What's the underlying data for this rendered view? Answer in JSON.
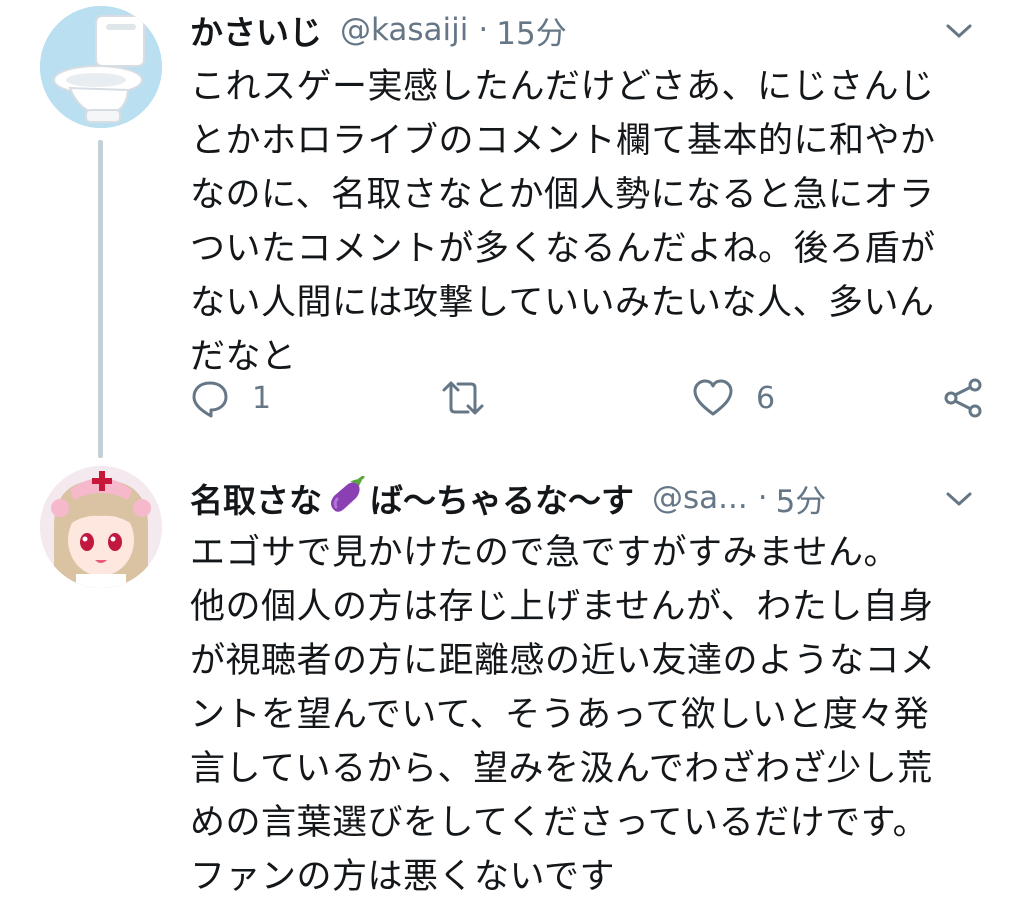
{
  "tweets": [
    {
      "name": "かさいじ",
      "handle": "@kasaiji",
      "separator": "·",
      "time": "15分",
      "avatar_icon": "toilet-icon",
      "text_lines": [
        "これスゲー実感したんだけどさあ、にじさんじ",
        "とかホロライブのコメント欄て基本的に和やか",
        "なのに、名取さなとか個人勢になると急にオラ",
        "ついたコメントが多くなるんだよね。後ろ盾が",
        "ない人間には攻撃していいみたいな人、多いん",
        "だなと"
      ],
      "actions": {
        "reply_icon": "reply-icon",
        "reply_count": "1",
        "retweet_icon": "retweet-icon",
        "like_icon": "heart-icon",
        "like_count": "6",
        "share_icon": "share-icon"
      }
    },
    {
      "name": "名取さな",
      "name_emoji": "eggplant-icon",
      "name_suffix": "ば〜ちゃるな〜す",
      "handle": "@sa...",
      "separator": "·",
      "time": "5分",
      "avatar_icon": "nurse-girl-avatar",
      "text_lines": [
        "エゴサで見かけたので急ですがすみません。",
        "他の個人の方は存じ上げませんが、わたし自身",
        "が視聴者の方に距離感の近い友達のようなコメ",
        "ントを望んでいて、そうあって欲しいと度々発",
        "言しているから、望みを汲んでわざわざ少し荒",
        "めの言葉選びをしてくださっているだけです。",
        "ファンの方は悪くないです"
      ]
    }
  ],
  "colors": {
    "text": "#14171a",
    "secondary": "#657786",
    "thread_line": "#c4cfd6",
    "background": "#ffffff"
  }
}
